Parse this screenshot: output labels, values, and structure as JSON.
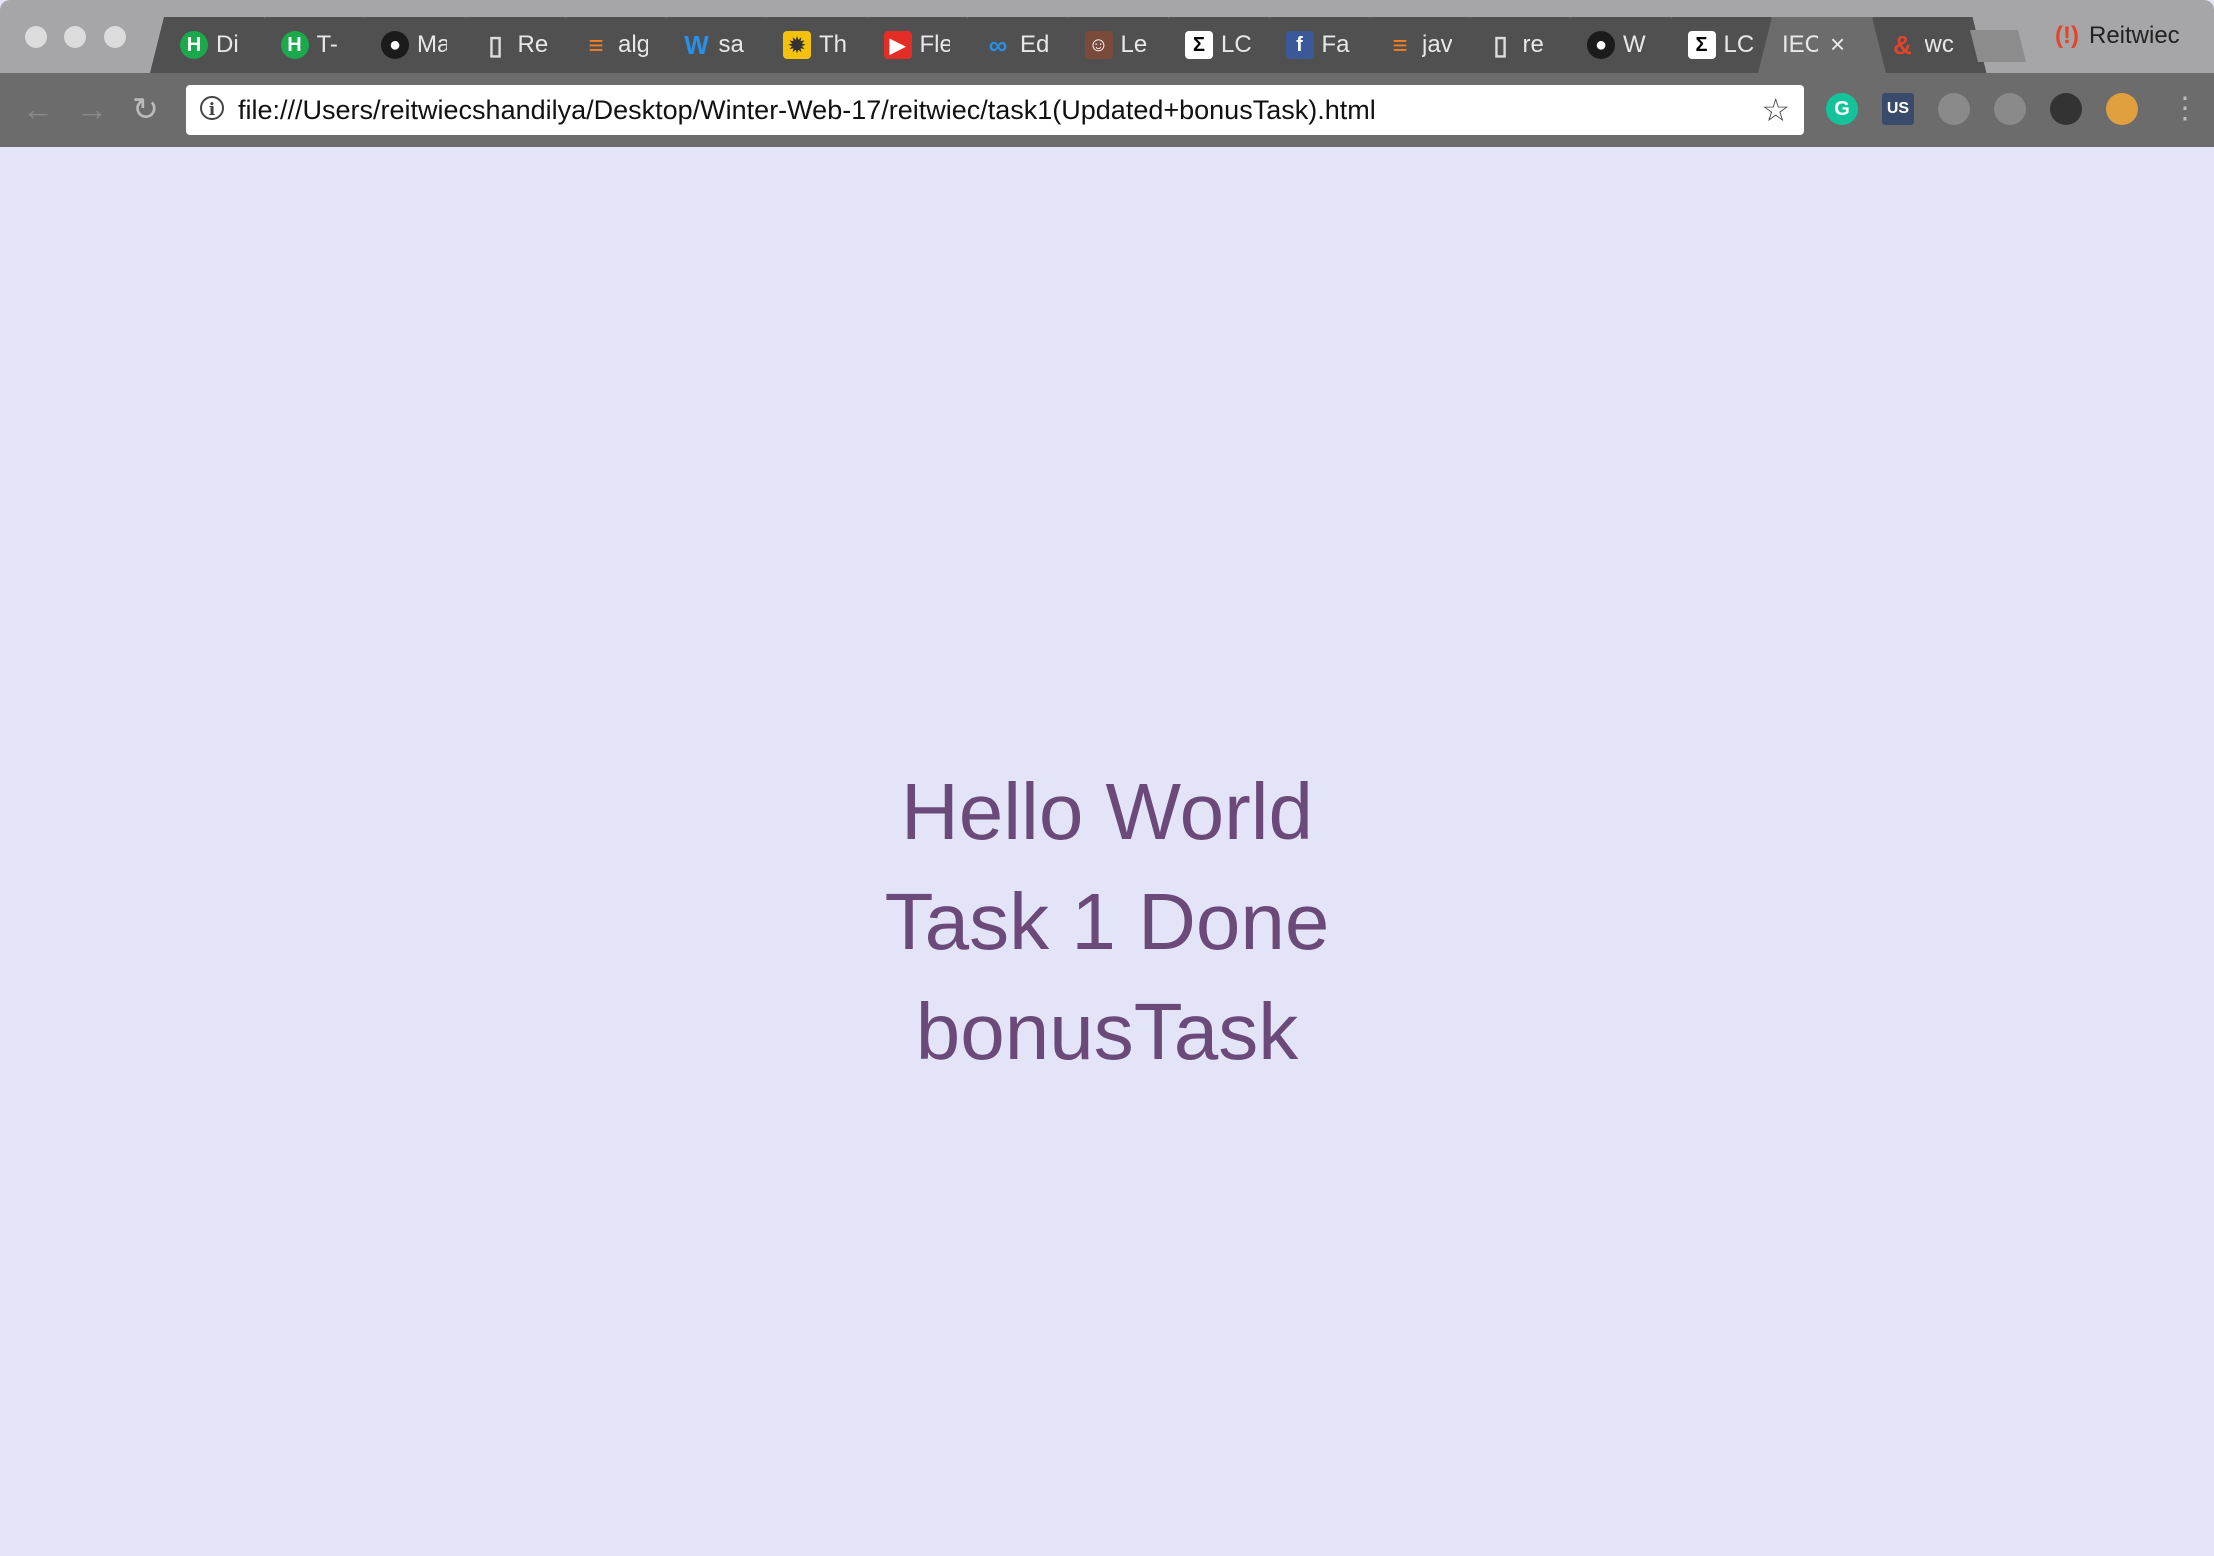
{
  "browser": {
    "tabs": [
      {
        "title": "Di",
        "icon": "hackerrank-icon",
        "color": "#1ba94c"
      },
      {
        "title": "T-",
        "icon": "hackerrank-icon",
        "color": "#1ba94c"
      },
      {
        "title": "Ma",
        "icon": "github-icon",
        "color": "#1b1b1b"
      },
      {
        "title": "Re",
        "icon": "document-icon",
        "color": "#505050"
      },
      {
        "title": "alg",
        "icon": "stackoverflow-icon",
        "color": "#505050"
      },
      {
        "title": "sa",
        "icon": "weebly-icon",
        "color": "#505050"
      },
      {
        "title": "Th",
        "icon": "lightbulb-icon",
        "color": "#f4c20d"
      },
      {
        "title": "Fle",
        "icon": "youtube-icon",
        "color": "#e52d27"
      },
      {
        "title": "Ed",
        "icon": "cloud-icon",
        "color": "#505050"
      },
      {
        "title": "Le",
        "icon": "avatar-icon",
        "color": "#7a4a3a"
      },
      {
        "title": "LC",
        "icon": "sigma-icon",
        "color": "#ffffff"
      },
      {
        "title": "Fa",
        "icon": "facebook-icon",
        "color": "#3b5998"
      },
      {
        "title": "jav",
        "icon": "stackoverflow-icon",
        "color": "#505050"
      },
      {
        "title": "re",
        "icon": "document-icon",
        "color": "#505050"
      },
      {
        "title": "W",
        "icon": "github-icon",
        "color": "#1b1b1b"
      },
      {
        "title": "LC",
        "icon": "sigma-icon",
        "color": "#ffffff"
      },
      {
        "title": "IEC",
        "icon": "",
        "color": "",
        "active": true
      },
      {
        "title": "wc",
        "icon": "ampersand-icon",
        "color": "#505050"
      }
    ],
    "close_glyph": "×",
    "profile_name": "Reitwiec",
    "url": "file:///Users/reitwiecshandilya/Desktop/Winter-Web-17/reitwiec/task1(Updated+bonusTask).html",
    "extensions": [
      {
        "name": "grammarly-icon",
        "label": "G",
        "color": "#15c39a"
      },
      {
        "name": "vpn-us-icon",
        "label": "US",
        "color": "#3a4a6a"
      },
      {
        "name": "ghostery-icon",
        "label": "",
        "color": "#8a8a8a"
      },
      {
        "name": "shield-icon",
        "label": "",
        "color": "#8a8a8a"
      },
      {
        "name": "guitar-icon",
        "label": "",
        "color": "#333333"
      },
      {
        "name": "globe-icon",
        "label": "",
        "color": "#e0a040"
      }
    ]
  },
  "page": {
    "lines": [
      "Hello World",
      "Task 1 Done",
      "bonusTask"
    ],
    "background": "#e4e4f8",
    "text_color": "#6b4a7a"
  }
}
